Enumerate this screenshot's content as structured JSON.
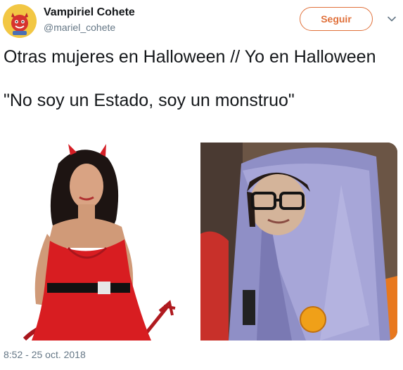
{
  "user": {
    "display_name": "Vampiriel Cohete",
    "handle": "@mariel_cohete",
    "avatar_icon": "devil-avatar-icon"
  },
  "header": {
    "follow_label": "Seguir",
    "more_icon": "chevron-down-icon"
  },
  "tweet": {
    "line1": "Otras mujeres en Halloween // Yo en Halloween",
    "line2": "\"No soy un Estado, soy un monstruo\""
  },
  "media": {
    "photos": [
      {
        "description_icon": "red-devil-costume-photo"
      },
      {
        "description_icon": "tent-costume-photo"
      }
    ]
  },
  "timestamp": "8:52 - 25 oct. 2018",
  "colors": {
    "accent": "#e0703a",
    "secondary_text": "#657786",
    "primary_text": "#14171a"
  }
}
